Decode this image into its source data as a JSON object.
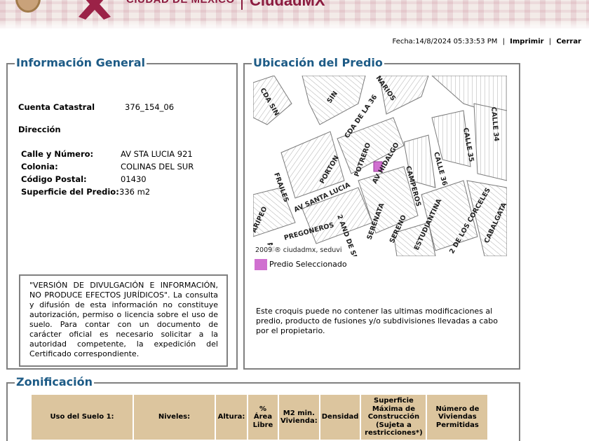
{
  "header": {
    "text_left": "CIUDAD DE MÉXICO",
    "text_right": "CiudadMX"
  },
  "topline": {
    "fecha_label": "Fecha:",
    "fecha_value": "14/8/2024 05:33:53 PM",
    "imprimir": "Imprimir",
    "cerrar": "Cerrar"
  },
  "info": {
    "title": "Información General",
    "cuenta_label": "Cuenta Catastral",
    "cuenta_value": "376_154_06",
    "direccion_label": "Dirección",
    "calle_label": "Calle y Número:",
    "calle_value": "AV STA LUCIA 921",
    "colonia_label": "Colonia:",
    "colonia_value": "COLINAS DEL SUR",
    "cp_label": "Código Postal:",
    "cp_value": "01430",
    "superficie_label": "Superficie del Predio:",
    "superficie_value": "336 m2",
    "disclaimer": "\"VERSIÓN DE DIVULGACIÓN E INFORMACIÓN, NO PRODUCE EFECTOS JURÍDICOS\". La consulta y difusión de esta información no constituye autorización, permiso o licencia sobre el uso de suelo. Para contar con un documento de carácter oficial es necesario solicitar a la autoridad competente, la expedición del Certificado correspondiente."
  },
  "ubicacion": {
    "title": "Ubicación del Predio",
    "map_credit": "2009 ® ciudadmx, seduvi",
    "streets": [
      "CDA SIN",
      "SIN",
      "NARIOS",
      "CDA DE LA 36",
      "AV HIDALGO",
      "POTRERO",
      "PORTON",
      "FRAILES",
      "AV SANTA LUCIA",
      "CAMPEROS",
      "CALLE 36",
      "CALLE 35",
      "CALLE 34",
      "SERENATA",
      "SERENO",
      "ESTUDIANTINA",
      "2 DE LOS CORCELES",
      "CABALGATA",
      "PREGONEROS",
      "2 AND DE SE",
      "ARIPEO",
      "AN"
    ],
    "legend_label": "Predio Seleccionado",
    "legend_color": "#d070d0",
    "croquis_note": "Este croquis puede no contener las ultimas modificaciones al predio, producto de fusiones y/o subdivisiones llevadas a cabo por el propietario."
  },
  "zonificacion": {
    "title": "Zonificación",
    "columns": [
      "Uso del Suelo 1:",
      "Niveles:",
      "Altura:",
      "% Área Libre",
      "M2 min. Vivienda:",
      "Densidad",
      "Superficie Máxima de Construcción (Sujeta a restricciones*)",
      "Número de Viviendas Permitidas"
    ],
    "header_color": "#dcc59e"
  },
  "colors": {
    "brand": "#8b1b3f",
    "panel_title": "#1d5b86",
    "panel_border": "#808080"
  }
}
